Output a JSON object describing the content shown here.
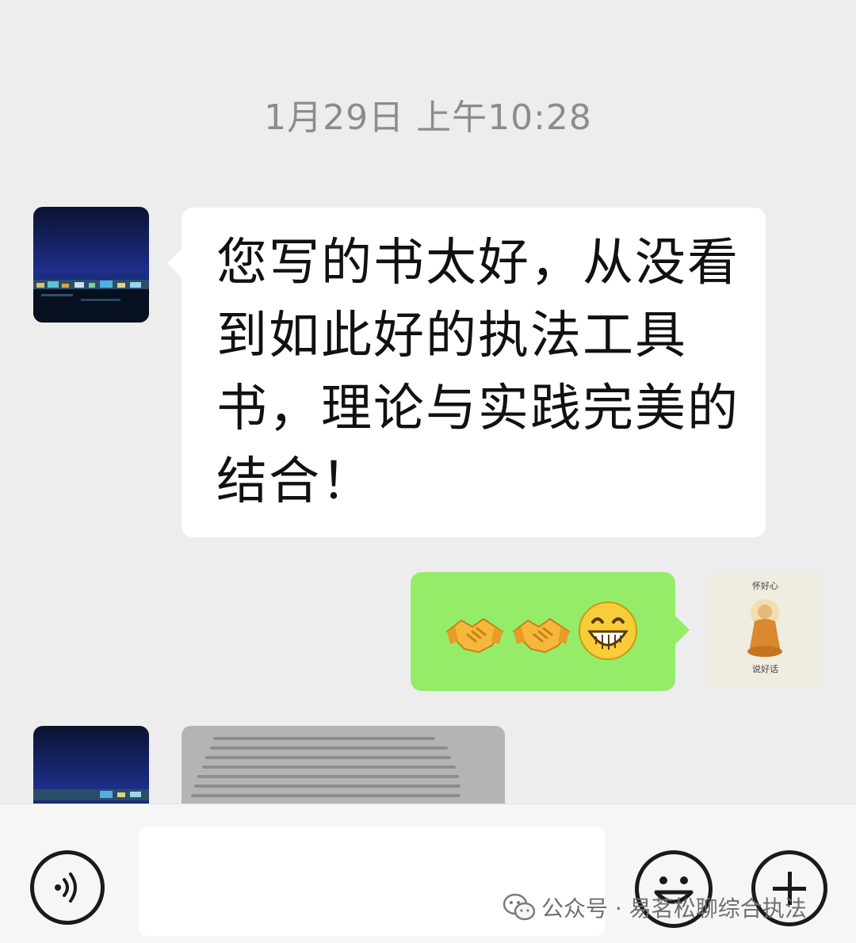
{
  "chat": {
    "timestamp": "1月29日 上午10:28",
    "messages": [
      {
        "side": "left",
        "type": "text",
        "text": "您写的书太好，从没看到如此好的执法工具书，理论与实践完美的结合！"
      },
      {
        "side": "right",
        "type": "emoji",
        "emojis": [
          "handshake-emoji",
          "handshake-emoji",
          "grin-emoji"
        ]
      },
      {
        "side": "left",
        "type": "image"
      }
    ],
    "my_avatar": {
      "caption_top": "怀好心",
      "caption_bottom": "说好话"
    }
  },
  "input_bar": {
    "input_value": "",
    "icons": [
      "voice-icon",
      "emoji-icon",
      "plus-icon"
    ]
  },
  "watermark": {
    "text": "公众号 · 易茗松聊综合执法"
  },
  "colors": {
    "background": "#ededed",
    "incoming_bubble": "#ffffff",
    "outgoing_bubble": "#95ec69",
    "timestamp_text": "#8c8c8c"
  }
}
